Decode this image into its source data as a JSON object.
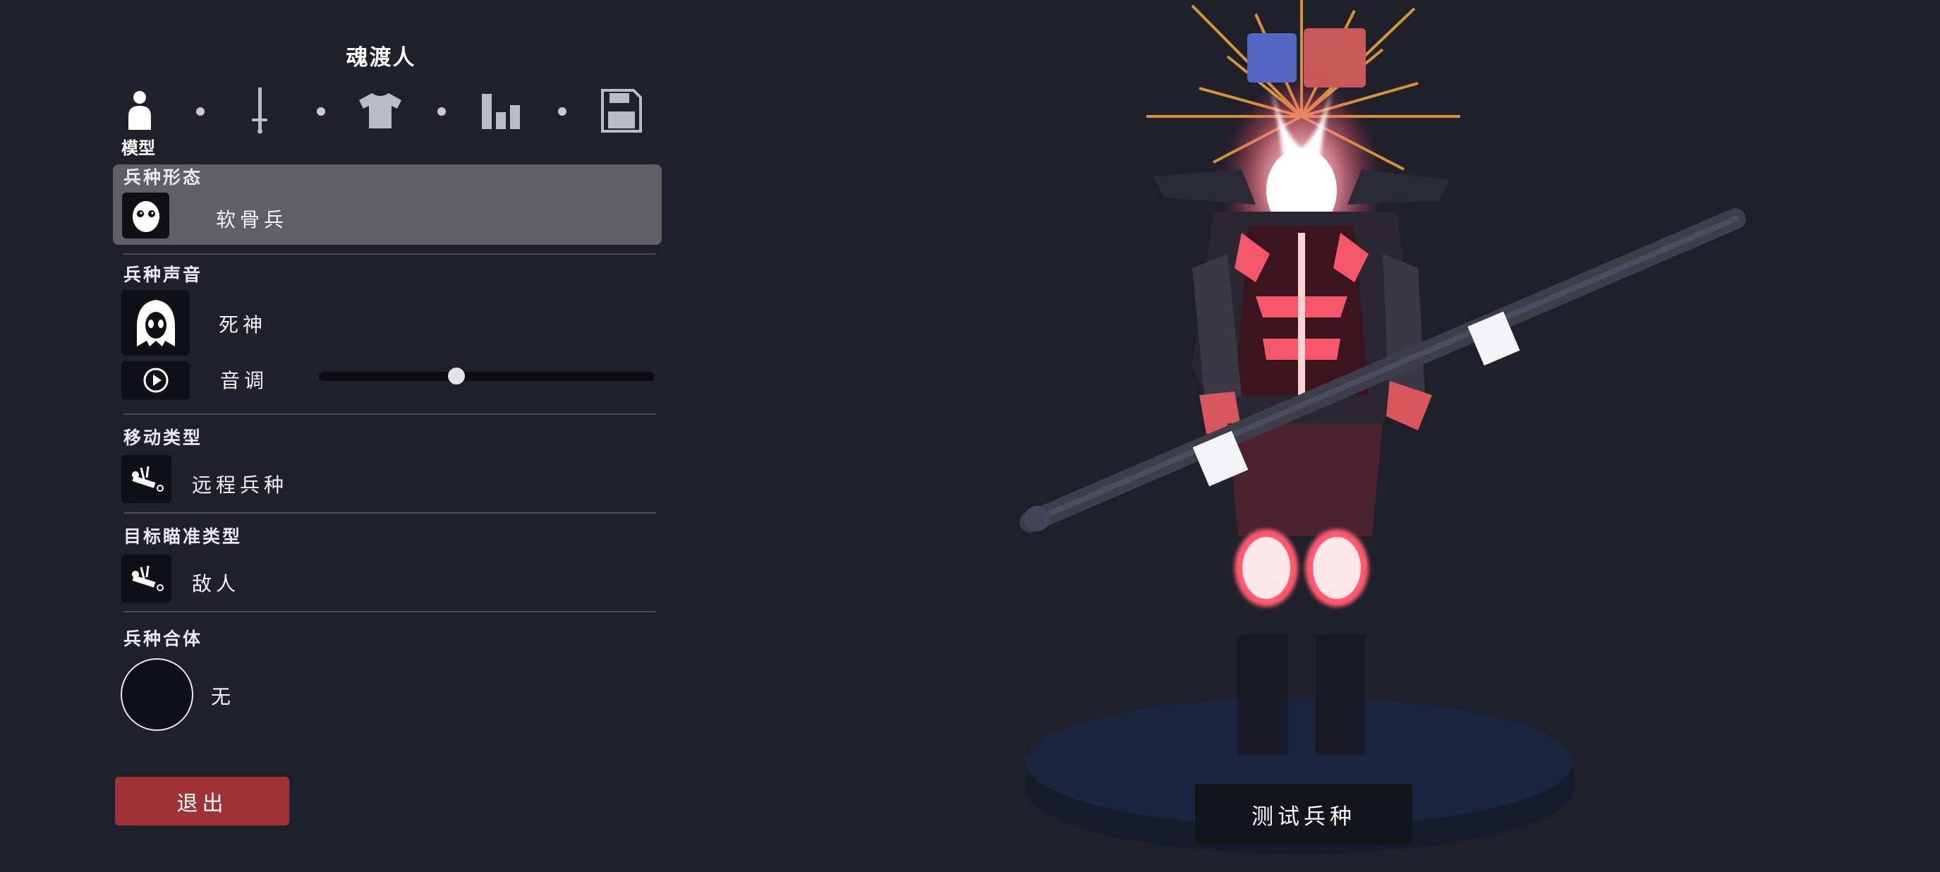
{
  "unit_name": "魂渡人",
  "tabs": [
    {
      "name": "model",
      "icon": "person-icon"
    },
    {
      "name": "weapon",
      "icon": "sword-icon"
    },
    {
      "name": "clothing",
      "icon": "shirt-icon"
    },
    {
      "name": "stats",
      "icon": "bar-chart-icon"
    },
    {
      "name": "save",
      "icon": "floppy-disk-icon"
    }
  ],
  "active_tab_label": "模型",
  "sections": {
    "unit_form": {
      "label": "兵种形态",
      "value": "软骨兵",
      "icon": "skull-face-icon"
    },
    "unit_voice": {
      "label": "兵种声音",
      "value": "死神",
      "icon": "reaper-hood-icon",
      "pitch_label": "音调",
      "pitch_level": 0.41,
      "play_icon": "play-icon"
    },
    "movement_type": {
      "label": "移动类型",
      "value": "远程兵种",
      "icon": "fallen-unit-icon"
    },
    "target_type": {
      "label": "目标瞄准类型",
      "value": "敌人",
      "icon": "fallen-unit-icon"
    },
    "unit_fusion": {
      "label": "兵种合体",
      "value": "无"
    }
  },
  "buttons": {
    "exit": "退出",
    "test_unit": "测试兵种"
  },
  "colors": {
    "background": "#20202b",
    "panel_highlight": "#5f5f64",
    "exit_button": "#9e3237",
    "team_blue": "#5566c0",
    "team_red": "#c9585a",
    "glow": "#ff4d63",
    "halo": "#e8a23a"
  }
}
